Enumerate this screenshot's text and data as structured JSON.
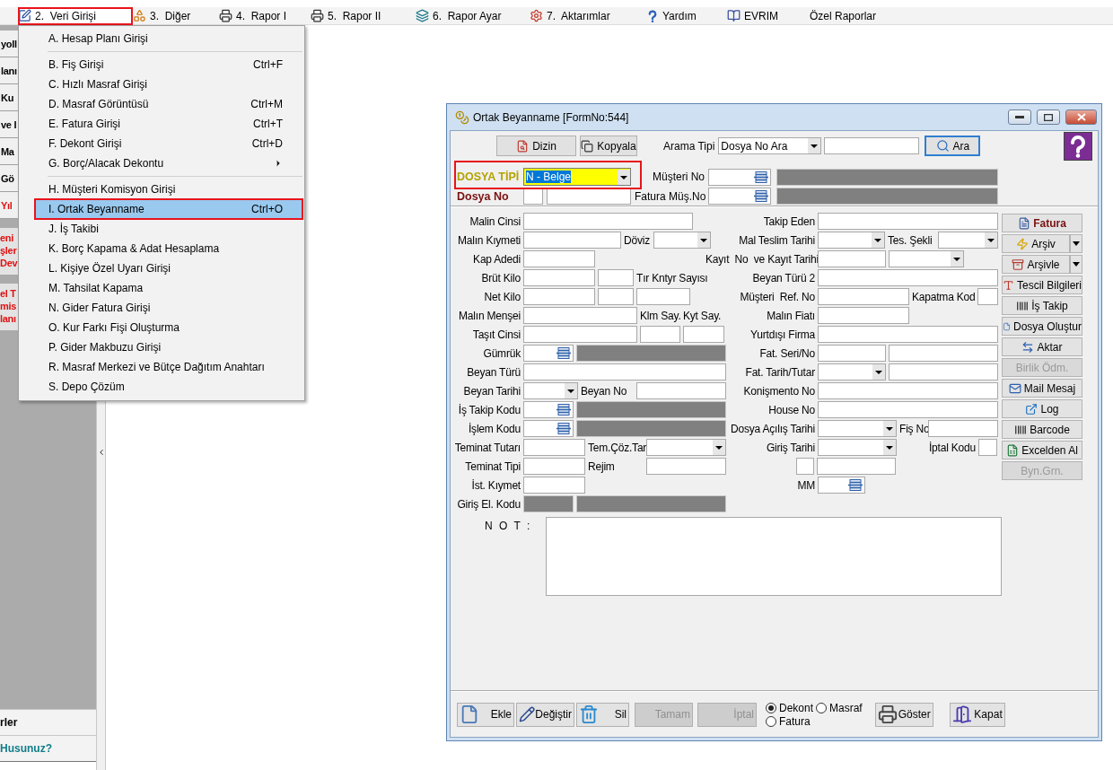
{
  "menu_bar": {
    "items": [
      {
        "label": "2.  Veri Girişi",
        "kind": "edit",
        "highlighted": true
      },
      {
        "label": "3.  Diğer",
        "kind": "shapes",
        "highlighted": false
      },
      {
        "label": "4.  Rapor I",
        "kind": "printer",
        "highlighted": false
      },
      {
        "label": "5.  Rapor II",
        "kind": "printer",
        "highlighted": false
      },
      {
        "label": "6.  Rapor Ayar",
        "kind": "stack",
        "highlighted": false
      },
      {
        "label": "7.  Aktarımlar",
        "kind": "gear",
        "highlighted": false
      },
      {
        "label": "Yardım",
        "kind": "help",
        "highlighted": false
      },
      {
        "label": "EVRIM",
        "kind": "book",
        "highlighted": false
      },
      {
        "label": "Özel Raporlar",
        "kind": "none",
        "highlighted": false
      }
    ]
  },
  "dropdown": {
    "items": [
      {
        "kind": "item",
        "label": "A. Hesap Planı Girişi",
        "submenu": false,
        "selected": false
      },
      {
        "kind": "separator"
      },
      {
        "kind": "item",
        "label": "B. Fiş Girişi",
        "shortcut": "Ctrl+F",
        "submenu": false,
        "selected": false
      },
      {
        "kind": "item",
        "label": "C. Hızlı Masraf Girişi",
        "submenu": false,
        "selected": false
      },
      {
        "kind": "item",
        "label": "D. Masraf Görüntüsü",
        "shortcut": "Ctrl+M",
        "submenu": false,
        "selected": false
      },
      {
        "kind": "item",
        "label": "E. Fatura Girişi",
        "shortcut": "Ctrl+T",
        "submenu": false,
        "selected": false
      },
      {
        "kind": "item",
        "label": "F. Dekont Girişi",
        "shortcut": "Ctrl+D",
        "submenu": false,
        "selected": false
      },
      {
        "kind": "item",
        "label": "G. Borç/Alacak Dekontu",
        "submenu": true,
        "selected": false
      },
      {
        "kind": "separator"
      },
      {
        "kind": "item",
        "label": "H. Müşteri Komisyon Girişi",
        "submenu": false,
        "selected": false
      },
      {
        "kind": "item",
        "label": "I. Ortak Beyanname",
        "shortcut": "Ctrl+O",
        "submenu": false,
        "selected": true
      },
      {
        "kind": "item",
        "label": "J. İş Takibi",
        "submenu": false,
        "selected": false
      },
      {
        "kind": "item",
        "label": "K. Borç Kapama & Adat Hesaplama",
        "submenu": false,
        "selected": false
      },
      {
        "kind": "item",
        "label": "L. Kişiye Özel Uyarı Girişi",
        "submenu": false,
        "selected": false
      },
      {
        "kind": "item",
        "label": "M. Tahsilat Kapama",
        "submenu": false,
        "selected": false
      },
      {
        "kind": "item",
        "label": "N. Gider Fatura Girişi",
        "submenu": false,
        "selected": false
      },
      {
        "kind": "item",
        "label": "O. Kur Farkı Fişi Oluşturma",
        "submenu": false,
        "selected": false
      },
      {
        "kind": "item",
        "label": "P. Gider Makbuzu Girişi",
        "submenu": false,
        "selected": false
      },
      {
        "kind": "item",
        "label": "R. Masraf Merkezi ve Bütçe Dağıtım Anahtarı",
        "submenu": false,
        "selected": false
      },
      {
        "kind": "item",
        "label": "S. Depo Çözüm",
        "submenu": false,
        "selected": false
      }
    ]
  },
  "left_panel": {
    "buttons": [
      {
        "label": "yoll",
        "alert": false
      },
      {
        "label": "lanı",
        "alert": false
      },
      {
        "label": "Ku",
        "alert": false
      },
      {
        "label": "ve I",
        "alert": false
      },
      {
        "label": "Ma",
        "alert": false
      },
      {
        "label": "Gö",
        "alert": false
      },
      {
        "label": "Yıl",
        "alert": true
      }
    ],
    "notices": [
      {
        "lines": [
          "eni",
          "şler",
          "Dev"
        ]
      },
      {
        "lines": [
          "el T",
          "mis",
          "lanı"
        ]
      }
    ],
    "footer": [
      {
        "label": "rler",
        "kind": "plain"
      },
      {
        "label": "Husunuz?",
        "kind": "link"
      }
    ]
  },
  "dialog": {
    "title": "Ortak Beyanname [FormNo:544]",
    "toolbar": {
      "tools": [
        {
          "label": "Dizin",
          "kind": "index"
        },
        {
          "label": "Kopyala",
          "kind": "copy"
        }
      ],
      "search_label": "Arama Tipi",
      "search_type": "Dosya No Ara",
      "search_button": "Ara"
    },
    "header": {
      "dosya_tipi": {
        "label": "DOSYA TİPİ",
        "value": "N - Belge",
        "highlighted": true
      },
      "dosya_no": {
        "label": "Dosya No"
      },
      "musteri_no": {
        "label": "Müşteri No"
      },
      "fatura_mus_no": {
        "label": "Fatura Müş.No"
      }
    },
    "left_rows": [
      {
        "label": "Malin Cinsi",
        "fields": [
          {
            "kind": "text"
          }
        ]
      },
      {
        "label": "Malın Kıymeti",
        "fields": [
          {
            "kind": "text"
          },
          {
            "kind": "label",
            "text": "Döviz"
          },
          {
            "kind": "combo"
          }
        ]
      },
      {
        "label": "Kap Adedi",
        "fields": [
          {
            "kind": "text"
          }
        ]
      },
      {
        "label": "Brüt Kilo",
        "fields": [
          {
            "kind": "text"
          },
          {
            "kind": "text"
          },
          {
            "kind": "label",
            "text": "Tır Kntyr Sayısı"
          }
        ]
      },
      {
        "label": "Net Kilo",
        "fields": [
          {
            "kind": "text"
          },
          {
            "kind": "text"
          },
          {
            "kind": "text"
          }
        ]
      },
      {
        "label": "Malın Menşei",
        "fields": [
          {
            "kind": "text"
          },
          {
            "kind": "label",
            "text": "Klm Say."
          },
          {
            "kind": "label",
            "text": "Kyt Say."
          }
        ]
      },
      {
        "label": "Taşıt Cinsi",
        "fields": [
          {
            "kind": "text"
          },
          {
            "kind": "text"
          },
          {
            "kind": "text"
          }
        ]
      },
      {
        "label": "Gümrük",
        "fields": [
          {
            "kind": "lookup"
          },
          {
            "kind": "readonly"
          }
        ]
      },
      {
        "label": "Beyan Türü",
        "fields": [
          {
            "kind": "text"
          }
        ]
      },
      {
        "label": "Beyan Tarihi",
        "fields": [
          {
            "kind": "combo"
          },
          {
            "kind": "label",
            "text": "Beyan No"
          },
          {
            "kind": "text"
          }
        ]
      },
      {
        "label": "İş Takip Kodu",
        "fields": [
          {
            "kind": "lookup"
          },
          {
            "kind": "readonly"
          }
        ]
      },
      {
        "label": "İşlem Kodu",
        "fields": [
          {
            "kind": "lookup"
          },
          {
            "kind": "readonly"
          }
        ]
      },
      {
        "label": "Teminat Tutarı",
        "fields": [
          {
            "kind": "text"
          },
          {
            "kind": "label",
            "text": "Tem.Çöz.Tar."
          },
          {
            "kind": "combo"
          }
        ]
      },
      {
        "label": "Teminat Tipi",
        "fields": [
          {
            "kind": "text"
          },
          {
            "kind": "label",
            "text": "Rejim"
          },
          {
            "kind": "text"
          }
        ]
      },
      {
        "label": "İst. Kıymet",
        "fields": [
          {
            "kind": "text"
          }
        ]
      },
      {
        "label": "Giriş El. Kodu",
        "fields": [
          {
            "kind": "readonly"
          },
          {
            "kind": "readonly"
          }
        ]
      }
    ],
    "right_rows": [
      {
        "label": "Takip Eden",
        "fields": [
          {
            "kind": "text"
          }
        ]
      },
      {
        "label": "Mal Teslim Tarihi",
        "fields": [
          {
            "kind": "combo"
          },
          {
            "kind": "label",
            "text": "Tes. Şekli"
          },
          {
            "kind": "combo"
          }
        ]
      },
      {
        "label": "Kayıt  No  ve Kayıt Tarihi",
        "fields": [
          {
            "kind": "text"
          },
          {
            "kind": "combo"
          }
        ]
      },
      {
        "label": "Beyan Türü 2",
        "fields": [
          {
            "kind": "text"
          }
        ]
      },
      {
        "label": "Müşteri  Ref. No",
        "fields": [
          {
            "kind": "text"
          },
          {
            "kind": "label",
            "text": "Kapatma Kod"
          },
          {
            "kind": "text"
          }
        ]
      },
      {
        "label": "Malın Fiatı",
        "fields": [
          {
            "kind": "text"
          }
        ]
      },
      {
        "label": "Yurtdışı Firma",
        "fields": [
          {
            "kind": "text"
          }
        ]
      },
      {
        "label": "Fat. Seri/No",
        "fields": [
          {
            "kind": "text"
          },
          {
            "kind": "text"
          }
        ]
      },
      {
        "label": "Fat. Tarih/Tutar",
        "fields": [
          {
            "kind": "combo"
          },
          {
            "kind": "text"
          }
        ]
      },
      {
        "label": "Konişmento No",
        "fields": [
          {
            "kind": "text"
          }
        ]
      },
      {
        "label": "House No",
        "fields": [
          {
            "kind": "text"
          }
        ]
      },
      {
        "label": "Dosya Açılış Tarihi",
        "fields": [
          {
            "kind": "combo"
          },
          {
            "kind": "label",
            "text": "Fiş No"
          },
          {
            "kind": "text"
          }
        ]
      },
      {
        "label": "Giriş Tarihi",
        "fields": [
          {
            "kind": "combo"
          },
          {
            "kind": "label",
            "text": "İptal Kodu"
          },
          {
            "kind": "text"
          }
        ]
      },
      {
        "fields": [
          {
            "kind": "text"
          },
          {
            "kind": "text"
          }
        ]
      },
      {
        "label": "MM",
        "fields": [
          {
            "kind": "lookup"
          }
        ]
      }
    ],
    "side_buttons": [
      {
        "label": "Fatura",
        "kind": "invoice",
        "disabled": false,
        "dropdown": false
      },
      {
        "label": "Arşiv",
        "kind": "bolt",
        "disabled": false,
        "dropdown": true
      },
      {
        "label": "Arşivle",
        "kind": "archive",
        "disabled": false,
        "dropdown": true
      },
      {
        "label": "Tescil Bilgileri",
        "kind": "registry",
        "disabled": false,
        "dropdown": false
      },
      {
        "label": "İş Takip",
        "kind": "track",
        "disabled": false,
        "dropdown": false
      },
      {
        "label": "Dosya Oluştur",
        "kind": "file",
        "disabled": false,
        "dropdown": false
      },
      {
        "label": "Aktar",
        "kind": "transfer",
        "disabled": false,
        "dropdown": false
      },
      {
        "label": "Birlik Ödm.",
        "kind": "plain",
        "disabled": true,
        "dropdown": false
      },
      {
        "label": "Mail Mesaj",
        "kind": "mail",
        "disabled": false,
        "dropdown": false
      },
      {
        "label": "Log",
        "kind": "log",
        "disabled": false,
        "dropdown": false
      },
      {
        "label": "Barcode",
        "kind": "track",
        "disabled": false,
        "dropdown": false
      },
      {
        "label": "Excelden Al",
        "kind": "excel",
        "disabled": false,
        "dropdown": false
      },
      {
        "label": "Byn.Grn.",
        "kind": "plain",
        "disabled": true,
        "dropdown": false
      }
    ],
    "note_label": "N O T :",
    "bottom_bar": {
      "left_actions": [
        {
          "label": "Ekle",
          "kind": "new",
          "disabled": false
        },
        {
          "label": "Değiştir",
          "kind": "edit",
          "disabled": false
        },
        {
          "label": "Sil",
          "kind": "delete",
          "disabled": false
        },
        {
          "label": "Tamam",
          "kind": "plain",
          "disabled": true
        },
        {
          "label": "İptal",
          "kind": "plain",
          "disabled": true
        }
      ],
      "document_type": [
        {
          "label": "Dekont",
          "selected": true
        },
        {
          "label": "Masraf",
          "selected": false
        },
        {
          "label": "Fatura",
          "selected": false
        }
      ],
      "right_actions": [
        {
          "label": "Göster",
          "kind": "print",
          "disabled": false
        },
        {
          "label": "Kapat",
          "kind": "exit",
          "disabled": false
        }
      ]
    }
  }
}
